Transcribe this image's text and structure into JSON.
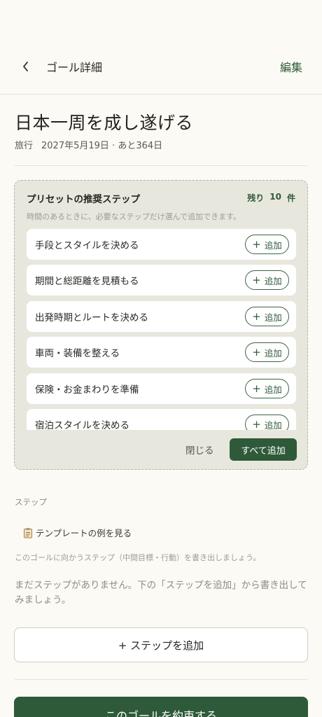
{
  "header": {
    "title": "ゴール詳細",
    "edit_label": "編集"
  },
  "goal": {
    "title": "日本一周を成し遂げる",
    "category": "旅行",
    "date": "2027年5月19日",
    "remaining": "· あと364日"
  },
  "preset": {
    "title": "プリセットの推奨ステップ",
    "remaining_label": "残り",
    "remaining_count": "10",
    "remaining_unit": "件",
    "description": "時間のあるときに、必要なステップだけ選んで追加できます。",
    "add_label": "追加",
    "items": [
      {
        "label": "手段とスタイルを決める"
      },
      {
        "label": "期間と総距離を見積もる"
      },
      {
        "label": "出発時期とルートを決める"
      },
      {
        "label": "車両・装備を整える"
      },
      {
        "label": "保険・お金まわりを準備"
      },
      {
        "label": "宿泊スタイルを決める"
      }
    ],
    "close_label": "閉じる",
    "add_all_label": "すべて追加"
  },
  "steps": {
    "heading": "ステップ",
    "template_link": "テンプレートの例を見る",
    "hint": "このゴールに向かうステップ（中間目標・行動）を書き出しましょう。",
    "empty_message": "まだステップがありません。下の「ステップを追加」から書き出してみましょう。",
    "add_button": "+ ステップを追加"
  },
  "footer": {
    "promise_button": "このゴールを約束する"
  },
  "colors": {
    "accent": "#2f5a3a",
    "background": "#fbfaf4",
    "card": "#e8e7de"
  },
  "icons": {
    "back": "chevron-left-icon",
    "template": "clipboard-icon",
    "add": "plus-icon"
  }
}
